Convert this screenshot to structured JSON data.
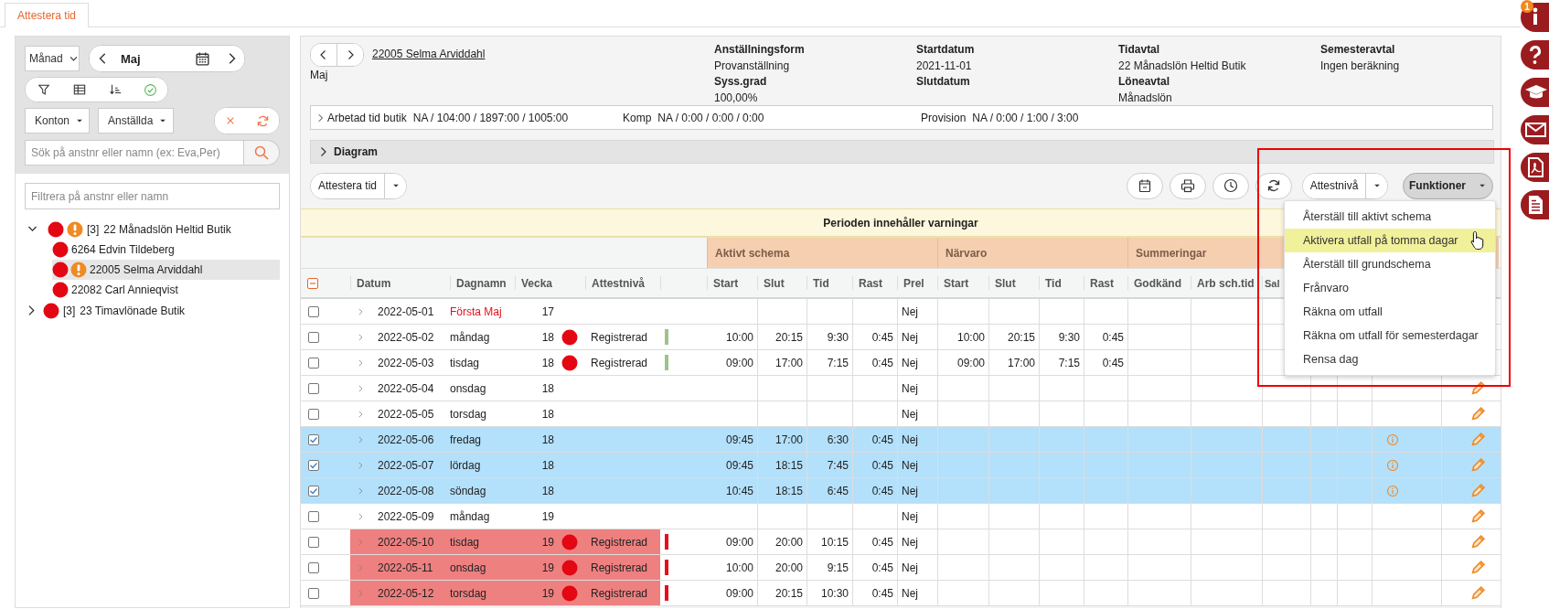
{
  "tabs": [
    {
      "label": "Attestera tid",
      "selected": true
    }
  ],
  "filters": {
    "period_type": "Månad",
    "period": "Maj",
    "accounts": "Konton",
    "employees": "Anställda",
    "search": {
      "placeholder": "Sök på anstnr eller namn (ex: Eva,Per)"
    },
    "tree_filter": {
      "placeholder": "Filtrera på anstnr eller namn"
    }
  },
  "tree": [
    {
      "count": "[3]",
      "label": "22 Månadslön Heltid Butik",
      "expanded": true,
      "warning": true,
      "selected": false,
      "children": [
        {
          "label": "6264 Edvin Tildeberg",
          "warning": false,
          "selected": false
        },
        {
          "label": "22005 Selma Arviddahl",
          "warning": true,
          "selected": true
        },
        {
          "label": "22082 Carl Annieqvist",
          "warning": false,
          "selected": false
        }
      ]
    },
    {
      "count": "[3]",
      "label": "23 Timavlönade Butik",
      "expanded": false,
      "warning": false,
      "selected": false
    }
  ],
  "employee": {
    "name": "22005 Selma Arviddahl",
    "period": "Maj",
    "info_columns": [
      [
        {
          "label": "Anställningsform",
          "value": "Provanställning"
        },
        {
          "label": "Syss.grad",
          "value": "100,00%"
        }
      ],
      [
        {
          "label": "Startdatum",
          "value": "2021-11-01"
        },
        {
          "label": "Slutdatum"
        }
      ],
      [
        {
          "label": "Tidavtal",
          "value": "22 Månadslön Heltid Butik"
        },
        {
          "label": "Löneavtal",
          "value": "Månadslön"
        }
      ],
      [
        {
          "label": "Semesteravtal",
          "value": "Ingen beräkning"
        }
      ]
    ]
  },
  "summary": [
    {
      "label": "Arbetad tid butik",
      "value": "NA / 104:00 / 1897:00 / 1005:00",
      "expandable": true
    },
    {
      "label": "Komp",
      "value": "NA / 0:00 / 0:00 / 0:00",
      "expandable": false
    },
    {
      "label": "Provision",
      "value": "NA / 0:00 / 1:00 / 3:00",
      "expandable": false
    }
  ],
  "diagram": {
    "label": "Diagram",
    "expanded": false
  },
  "toolbar": {
    "attest_button": "Attestera tid",
    "level_button": "Attestnivå",
    "functions_button": "Funktioner",
    "functions_open": true
  },
  "functions_menu": [
    {
      "label": "Återställ till aktivt schema",
      "selected": false
    },
    {
      "label": "Aktivera utfall på tomma dagar",
      "selected": true
    },
    {
      "label": "Återställ till grundschema",
      "selected": false
    },
    {
      "label": "Frånvaro",
      "selected": false
    },
    {
      "label": "Räkna om utfall",
      "selected": false
    },
    {
      "label": "Räkna om utfall för semesterdagar",
      "selected": false
    },
    {
      "label": "Rensa dag",
      "selected": false
    }
  ],
  "banner": "Perioden innehåller varningar",
  "notification_count": "1",
  "table": {
    "select_all": {
      "checked": false,
      "partial": true
    },
    "groups": [
      {
        "label": "Aktivt schema"
      },
      {
        "label": "Närvaro"
      },
      {
        "label": "Summeringar"
      }
    ],
    "columns": [
      "Datum",
      "Dagnamn",
      "Vecka",
      "Attestnivå",
      "Start",
      "Slut",
      "Tid",
      "Rast",
      "Prel",
      "Start",
      "Slut",
      "Tid",
      "Rast",
      "Godkänd",
      "Arb sch.tid",
      "Sal"
    ],
    "rows": [
      {
        "checked": false,
        "date": "2022-05-01",
        "day": "Första Maj",
        "holiday": true,
        "week": "17",
        "prel": "Nej",
        "warning": false,
        "info": false,
        "edit": false
      },
      {
        "checked": false,
        "date": "2022-05-02",
        "day": "måndag",
        "holiday": false,
        "week": "18",
        "attest": "Registrerad",
        "color": "#9dc48b",
        "schedule": [
          "10:00",
          "20:15",
          "9:30",
          "0:45"
        ],
        "prel": "Nej",
        "presence": [
          "10:00",
          "20:15",
          "9:30",
          "0:45"
        ],
        "warning": false,
        "info": false,
        "edit": false
      },
      {
        "checked": false,
        "date": "2022-05-03",
        "day": "tisdag",
        "holiday": false,
        "week": "18",
        "attest": "Registrerad",
        "color": "#9dc48b",
        "schedule": [
          "09:00",
          "17:00",
          "7:15",
          "0:45"
        ],
        "prel": "Nej",
        "presence": [
          "09:00",
          "17:00",
          "7:15",
          "0:45"
        ],
        "warning": false,
        "info": false,
        "edit": false
      },
      {
        "checked": false,
        "date": "2022-05-04",
        "day": "onsdag",
        "holiday": false,
        "week": "18",
        "prel": "Nej",
        "warning": false,
        "info": false,
        "edit": true
      },
      {
        "checked": false,
        "date": "2022-05-05",
        "day": "torsdag",
        "holiday": false,
        "week": "18",
        "prel": "Nej",
        "warning": false,
        "info": false,
        "edit": true
      },
      {
        "checked": true,
        "date": "2022-05-06",
        "day": "fredag",
        "holiday": false,
        "week": "18",
        "schedule": [
          "09:45",
          "17:00",
          "6:30",
          "0:45"
        ],
        "prel": "Nej",
        "warning": false,
        "info": true,
        "edit": true
      },
      {
        "checked": true,
        "date": "2022-05-07",
        "day": "lördag",
        "holiday": false,
        "week": "18",
        "schedule": [
          "09:45",
          "18:15",
          "7:45",
          "0:45"
        ],
        "prel": "Nej",
        "warning": false,
        "info": true,
        "edit": true
      },
      {
        "checked": true,
        "date": "2022-05-08",
        "day": "söndag",
        "holiday": false,
        "week": "18",
        "schedule": [
          "10:45",
          "18:15",
          "6:45",
          "0:45"
        ],
        "prel": "Nej",
        "warning": false,
        "info": true,
        "edit": true
      },
      {
        "checked": false,
        "date": "2022-05-09",
        "day": "måndag",
        "holiday": false,
        "week": "19",
        "prel": "Nej",
        "warning": false,
        "info": false,
        "edit": true
      },
      {
        "checked": false,
        "date": "2022-05-10",
        "day": "tisdag",
        "holiday": false,
        "week": "19",
        "attest": "Registrerad",
        "color": "#e3101b",
        "schedule": [
          "09:00",
          "20:00",
          "10:15",
          "0:45"
        ],
        "prel": "Nej",
        "warning": true,
        "info": false,
        "edit": true
      },
      {
        "checked": false,
        "date": "2022-05-11",
        "day": "onsdag",
        "holiday": false,
        "week": "19",
        "attest": "Registrerad",
        "color": "#e3101b",
        "schedule": [
          "10:00",
          "20:00",
          "9:15",
          "0:45"
        ],
        "prel": "Nej",
        "warning": true,
        "info": false,
        "edit": true
      },
      {
        "checked": false,
        "date": "2022-05-12",
        "day": "torsdag",
        "holiday": false,
        "week": "19",
        "attest": "Registrerad",
        "color": "#e3101b",
        "schedule": [
          "09:00",
          "20:15",
          "10:30",
          "0:45"
        ],
        "prel": "Nej",
        "warning": true,
        "info": false,
        "edit": true
      }
    ]
  }
}
